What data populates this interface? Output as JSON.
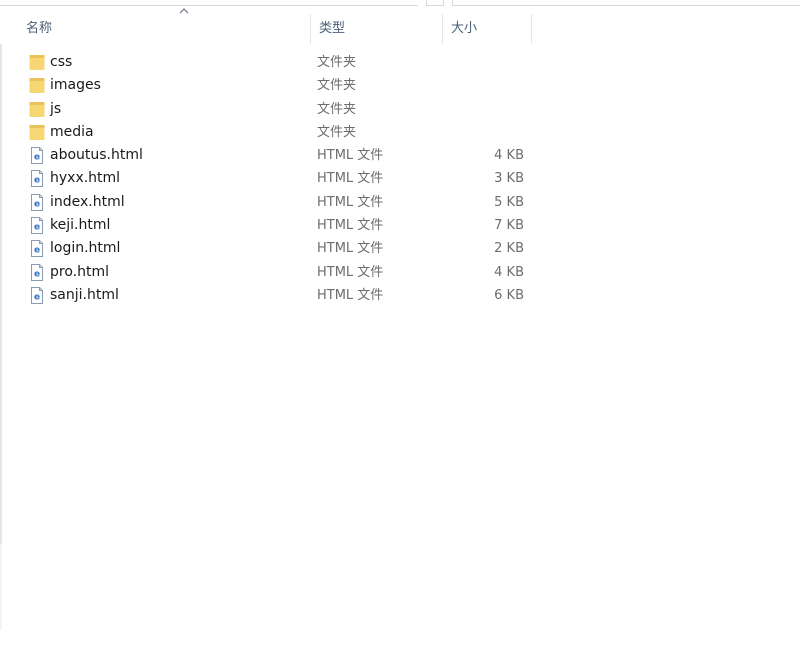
{
  "columns": {
    "name": "名称",
    "type": "类型",
    "size": "大小"
  },
  "sort": {
    "column": "name",
    "direction": "ascending",
    "icon": "chevron-up-icon"
  },
  "colors": {
    "folder": "#f7d774",
    "folder_shade": "#e9c25a",
    "html_icon_blue": "#2e6fc7",
    "header_text": "#4c607a"
  },
  "files": [
    {
      "name": "css",
      "type": "文件夹",
      "size": "",
      "icon": "folder-icon"
    },
    {
      "name": "images",
      "type": "文件夹",
      "size": "",
      "icon": "folder-icon"
    },
    {
      "name": "js",
      "type": "文件夹",
      "size": "",
      "icon": "folder-icon"
    },
    {
      "name": "media",
      "type": "文件夹",
      "size": "",
      "icon": "folder-icon"
    },
    {
      "name": "aboutus.html",
      "type": "HTML 文件",
      "size": "4 KB",
      "icon": "html-file-icon"
    },
    {
      "name": "hyxx.html",
      "type": "HTML 文件",
      "size": "3 KB",
      "icon": "html-file-icon"
    },
    {
      "name": "index.html",
      "type": "HTML 文件",
      "size": "5 KB",
      "icon": "html-file-icon"
    },
    {
      "name": "keji.html",
      "type": "HTML 文件",
      "size": "7 KB",
      "icon": "html-file-icon"
    },
    {
      "name": "login.html",
      "type": "HTML 文件",
      "size": "2 KB",
      "icon": "html-file-icon"
    },
    {
      "name": "pro.html",
      "type": "HTML 文件",
      "size": "4 KB",
      "icon": "html-file-icon"
    },
    {
      "name": "sanji.html",
      "type": "HTML 文件",
      "size": "6 KB",
      "icon": "html-file-icon"
    }
  ]
}
